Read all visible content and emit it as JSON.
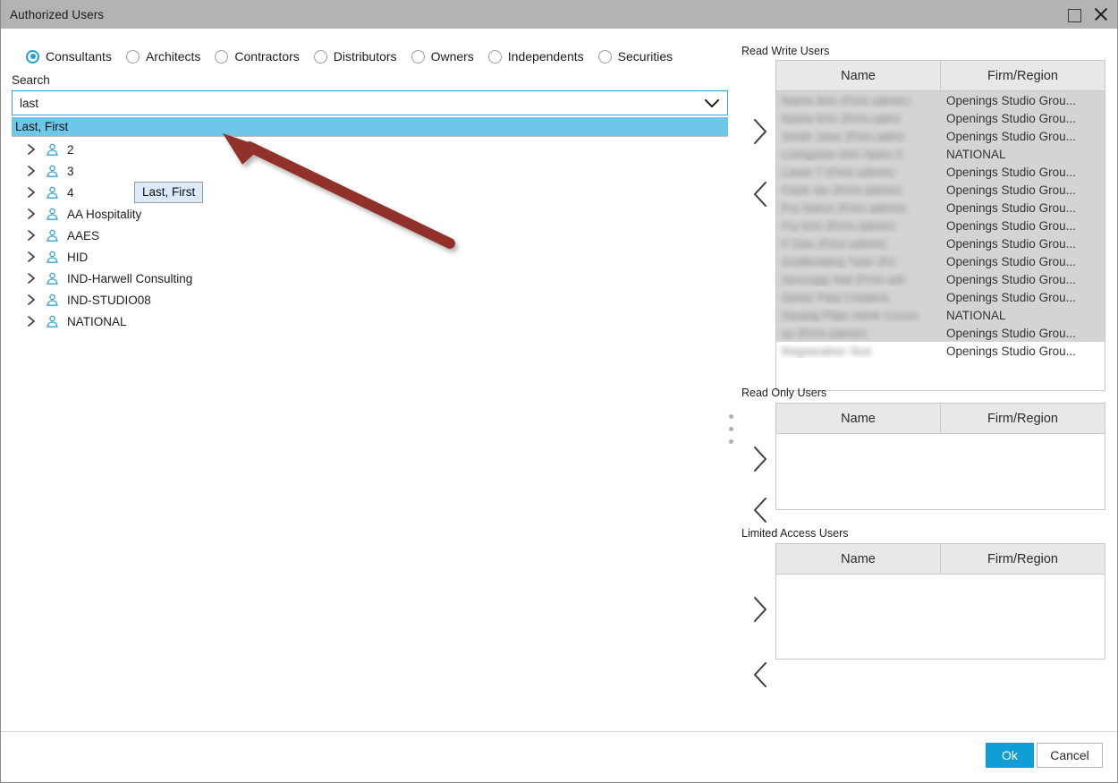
{
  "window": {
    "title": "Authorized Users",
    "maximize_icon": "maximize-icon",
    "close_icon": "close-icon"
  },
  "filters": {
    "options": [
      {
        "label": "Consultants",
        "selected": true
      },
      {
        "label": "Architects",
        "selected": false
      },
      {
        "label": "Contractors",
        "selected": false
      },
      {
        "label": "Distributors",
        "selected": false
      },
      {
        "label": "Owners",
        "selected": false
      },
      {
        "label": "Independents",
        "selected": false
      },
      {
        "label": "Securities",
        "selected": false
      }
    ]
  },
  "search": {
    "label": "Search",
    "value": "last",
    "placeholder": "",
    "chevron_icon": "chevron-down-icon",
    "suggestion": "Last, First"
  },
  "tooltip": {
    "text": "Last, First"
  },
  "tree": {
    "items": [
      {
        "label": "2",
        "icon": "person-icon",
        "expander": "chevron-right-icon"
      },
      {
        "label": "3",
        "icon": "person-icon",
        "expander": "chevron-right-icon"
      },
      {
        "label": "4",
        "icon": "person-icon",
        "expander": "chevron-right-icon"
      },
      {
        "label": "AA Hospitality",
        "icon": "person-icon",
        "expander": "chevron-right-icon"
      },
      {
        "label": "AAES",
        "icon": "person-icon",
        "expander": "chevron-right-icon"
      },
      {
        "label": "HID",
        "icon": "person-icon",
        "expander": "chevron-right-icon"
      },
      {
        "label": "IND-Harwell Consulting",
        "icon": "person-icon",
        "expander": "chevron-right-icon"
      },
      {
        "label": "IND-STUDIO08",
        "icon": "person-icon",
        "expander": "chevron-right-icon"
      },
      {
        "label": "NATIONAL",
        "icon": "person-icon",
        "expander": "chevron-right-icon"
      }
    ]
  },
  "panels": {
    "read_write": {
      "label": "Read Write Users",
      "columns": [
        "Name",
        "Firm/Region"
      ],
      "add_icon": "chevron-right-icon",
      "remove_icon": "chevron-left-icon",
      "rows": [
        {
          "name": "[redacted]",
          "firm": "Openings Studio Grou..."
        },
        {
          "name": "[redacted]",
          "firm": "Openings Studio Grou..."
        },
        {
          "name": "[redacted]",
          "firm": "Openings Studio Grou..."
        },
        {
          "name": "[redacted]",
          "firm": "NATIONAL"
        },
        {
          "name": "[redacted]",
          "firm": "Openings Studio Grou..."
        },
        {
          "name": "[redacted]",
          "firm": "Openings Studio Grou..."
        },
        {
          "name": "[redacted]",
          "firm": "Openings Studio Grou..."
        },
        {
          "name": "[redacted]",
          "firm": "Openings Studio Grou..."
        },
        {
          "name": "[redacted]",
          "firm": "Openings Studio Grou..."
        },
        {
          "name": "[redacted]",
          "firm": "Openings Studio Grou..."
        },
        {
          "name": "[redacted]",
          "firm": "Openings Studio Grou..."
        },
        {
          "name": "[redacted]",
          "firm": "Openings Studio Grou..."
        },
        {
          "name": "[redacted]",
          "firm": "NATIONAL"
        },
        {
          "name": "[redacted]",
          "firm": "Openings Studio Grou..."
        },
        {
          "name": "[redacted]",
          "firm": "Openings Studio Grou..."
        }
      ]
    },
    "read_only": {
      "label": "Read Only Users",
      "columns": [
        "Name",
        "Firm/Region"
      ],
      "add_icon": "chevron-right-icon",
      "remove_icon": "chevron-left-icon",
      "rows": []
    },
    "limited_access": {
      "label": "Limited Access Users",
      "columns": [
        "Name",
        "Firm/Region"
      ],
      "add_icon": "chevron-right-icon",
      "remove_icon": "chevron-left-icon",
      "rows": []
    }
  },
  "footer": {
    "ok_label": "Ok",
    "cancel_label": "Cancel"
  },
  "annotation": {
    "arrow_color": "#90302a",
    "type": "arrow-pointer"
  },
  "colors": {
    "titlebar": "#b3b3b3",
    "accent": "#119ed4",
    "suggestion_highlight": "#6ec7e8",
    "search_border": "#34a6dc",
    "grid_header": "#e8e8e8",
    "tooltip_bg": "#dce9f8"
  }
}
